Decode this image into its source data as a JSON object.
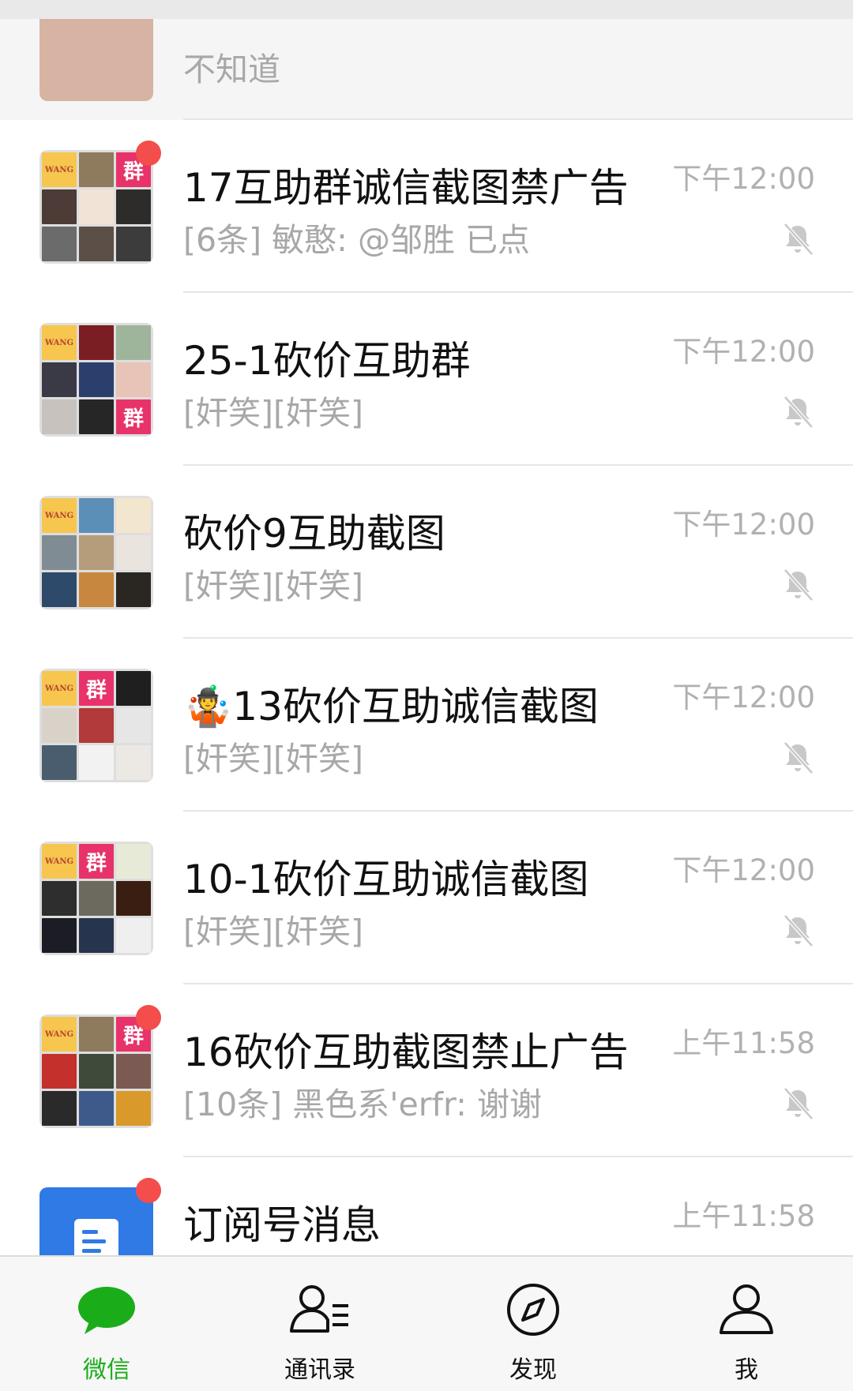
{
  "chats": [
    {
      "title": "",
      "preview": "不知道",
      "time": "",
      "unread_dot": false,
      "muted": false
    },
    {
      "title": "17互助群诚信截图禁广告",
      "preview": "[6条] 敏憨: @邹胜 已点",
      "time": "下午12:00",
      "unread_dot": true,
      "muted": true
    },
    {
      "title": "25-1砍价互助群",
      "preview": "[奸笑][奸笑]",
      "time": "下午12:00",
      "unread_dot": false,
      "muted": true
    },
    {
      "title": "砍价9互助截图",
      "preview": "[奸笑][奸笑]",
      "time": "下午12:00",
      "unread_dot": false,
      "muted": true
    },
    {
      "title": "13砍价互助诚信截图",
      "title_emoji": "🤹",
      "preview": "[奸笑][奸笑]",
      "time": "下午12:00",
      "unread_dot": false,
      "muted": true
    },
    {
      "title": "10-1砍价互助诚信截图",
      "preview": "[奸笑][奸笑]",
      "time": "下午12:00",
      "unread_dot": false,
      "muted": true
    },
    {
      "title": "16砍价互助截图禁止广告",
      "preview": "[10条] 黑色系'erfr: 谢谢",
      "time": "上午11:58",
      "unread_dot": true,
      "muted": true
    },
    {
      "title": "订阅号消息",
      "preview": "",
      "time": "上午11:58",
      "unread_dot": true,
      "muted": false
    }
  ],
  "avatar_tiles": {
    "wang": "WANG",
    "qun": "群"
  },
  "tabbar": {
    "items": [
      {
        "label": "微信",
        "icon": "chat-bubble-icon",
        "active": true
      },
      {
        "label": "通讯录",
        "icon": "contacts-icon",
        "active": false
      },
      {
        "label": "发现",
        "icon": "compass-icon",
        "active": false
      },
      {
        "label": "我",
        "icon": "person-icon",
        "active": false
      }
    ]
  },
  "colors": {
    "accent_green": "#1aad19",
    "unread_red": "#f34e4b",
    "qun_tile": "#e7336a",
    "wang_tile": "#f6c64f",
    "subscribe_blue": "#2f7ae5"
  }
}
